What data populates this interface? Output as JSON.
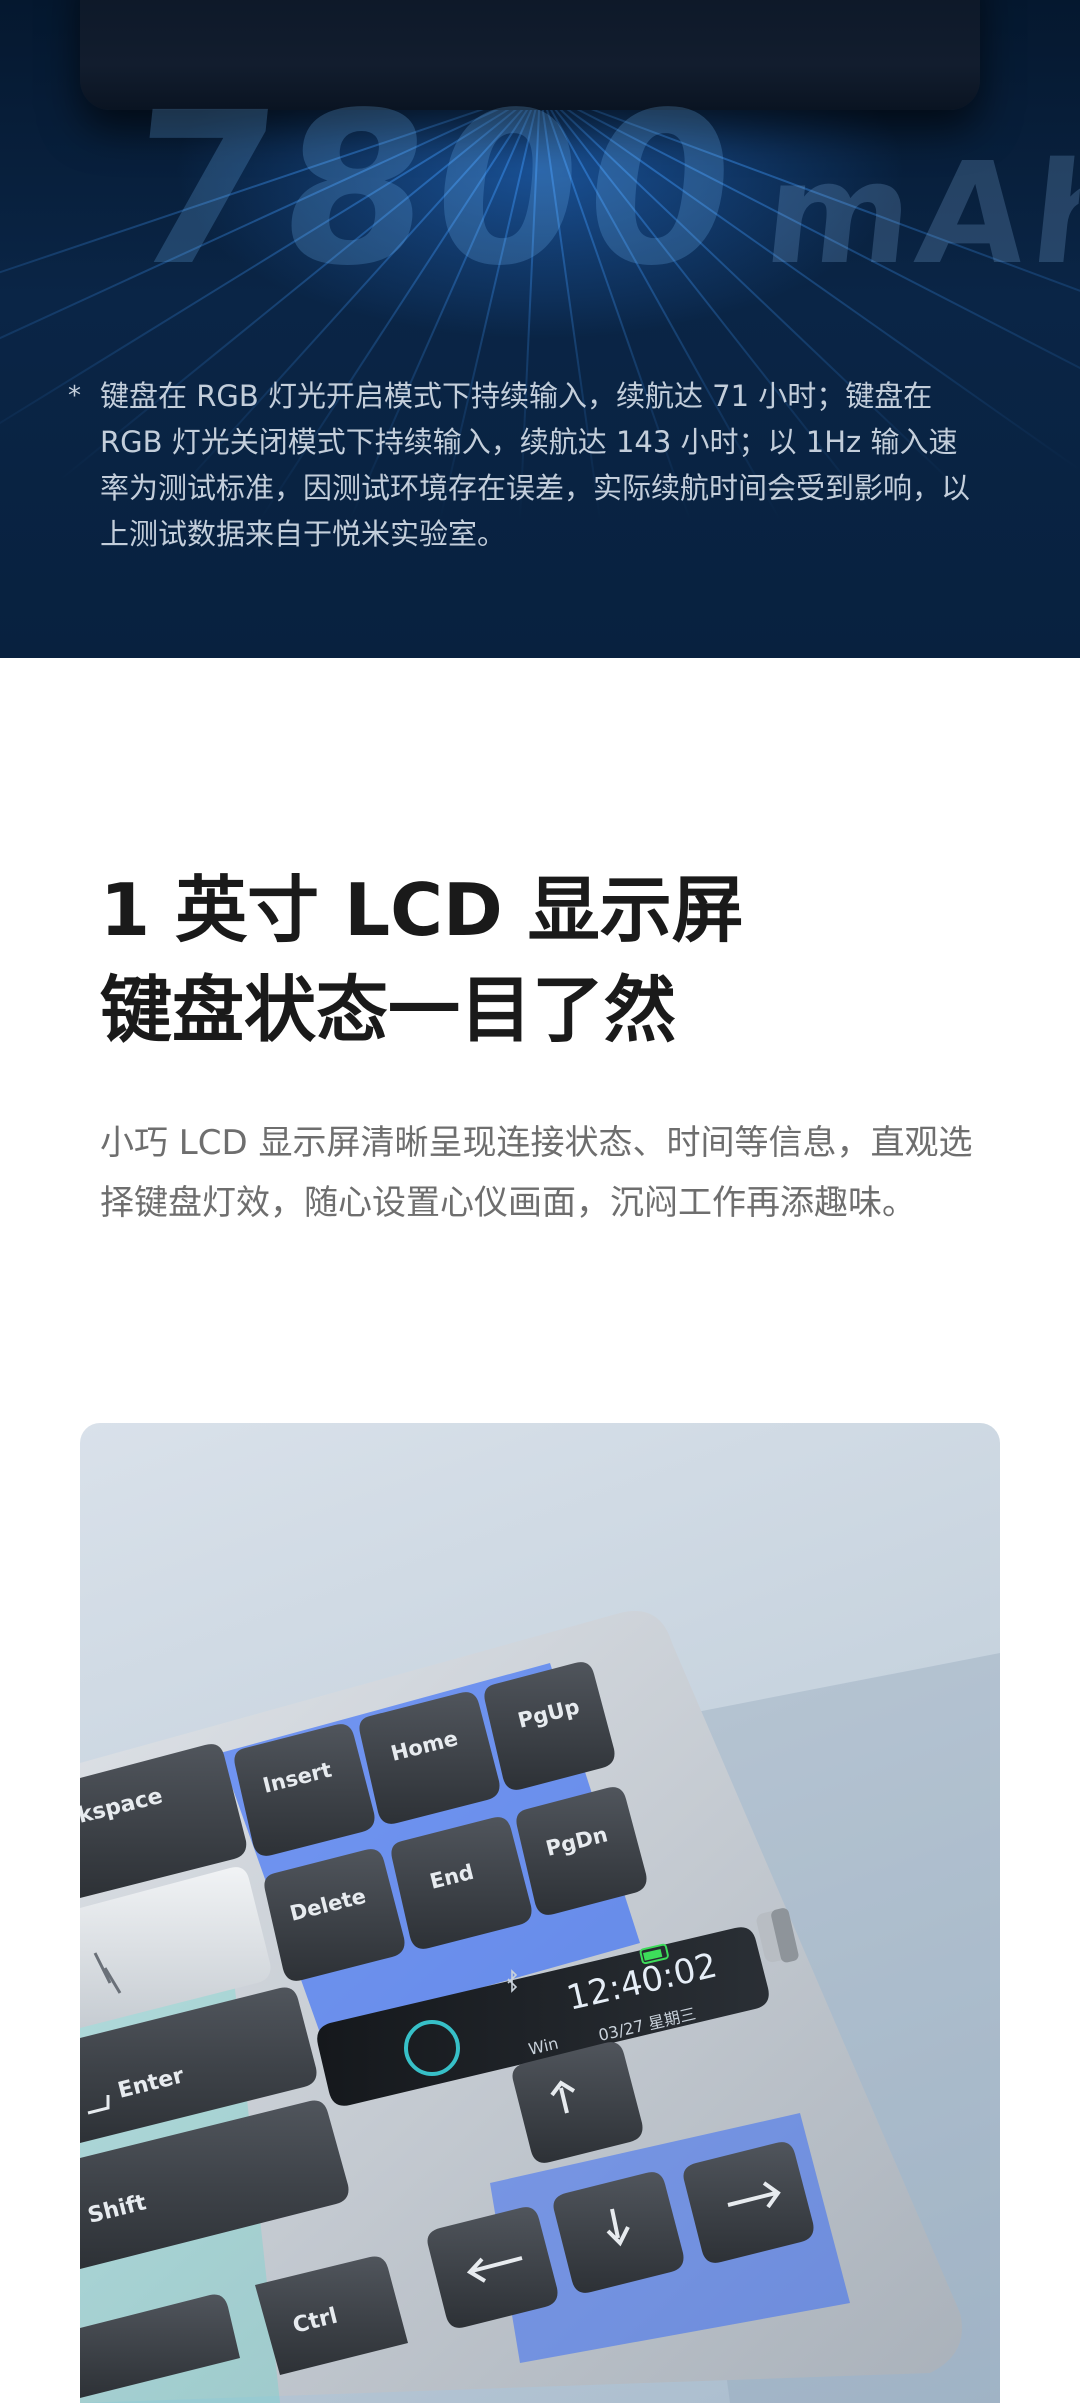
{
  "hero": {
    "big_number": "7800",
    "unit": "mAh",
    "footnote_mark": "*",
    "footnote": "键盘在 RGB 灯光开启模式下持续输入，续航达 71 小时；键盘在 RGB 灯光关闭模式下持续输入，续航达 143 小时；以 1Hz 输入速率为测试标准，因测试环境存在误差，实际续航时间会受到影响，以上测试数据来自于悦米实验室。"
  },
  "section": {
    "title_line1": "1 英寸 LCD 显示屏",
    "title_line2": "键盘状态一目了然",
    "description": "小巧 LCD 显示屏清晰呈现连接状态、时间等信息，直观选择键盘灯效，随心设置心仪画面，沉闷工作再添趣味。"
  },
  "keyboard": {
    "keys": {
      "backspace": "kspace",
      "insert": "Insert",
      "home": "Home",
      "pgup": "PgUp",
      "delete": "Delete",
      "end": "End",
      "pgdn": "PgDn",
      "enter": "Enter",
      "shift": "Shift",
      "ctrl": "Ctrl"
    },
    "lcd": {
      "time": "12:40:02",
      "os": "Win",
      "date": "03/27 星期三"
    },
    "colors": {
      "accent_blue": "#1e5bff",
      "backlight_cyan": "#45e0d0",
      "lcd_battery": "#3ddc5a"
    }
  }
}
